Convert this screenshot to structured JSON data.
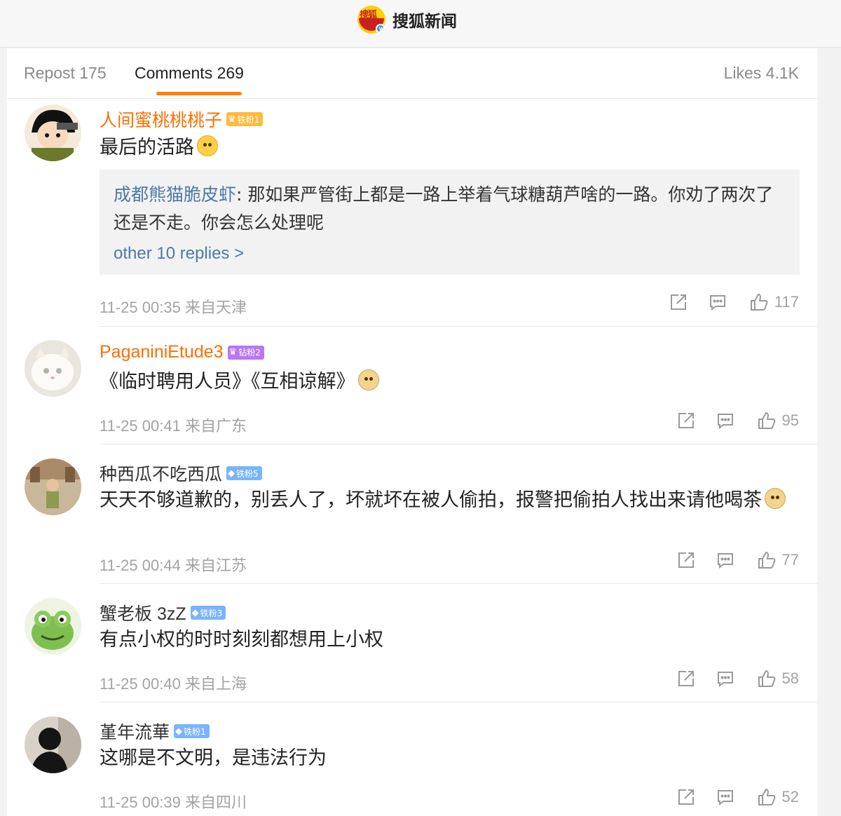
{
  "header": {
    "brand_name": "搜狐新闻",
    "logo_text": "搜狐"
  },
  "tabs": {
    "repost": "Repost 175",
    "comments": "Comments 269",
    "likes": "Likes 4.1K"
  },
  "comments": [
    {
      "username": "人间蜜桃桃桃子",
      "badge": "铁粉1",
      "text": "最后的活路",
      "reply": {
        "user": "成都熊猫脆皮虾",
        "text": ": 那如果严管街上都是一路上举着气球糖葫芦啥的一路。你劝了两次了还是不走。你会怎么处理呢",
        "more": "other 10 replies >"
      },
      "time": "11-25 00:35",
      "location": "来自天津",
      "likes": "117"
    },
    {
      "username": "PaganiniEtude3",
      "badge": "钻粉2",
      "text": "《临时聘用人员》《互相谅解》",
      "time": "11-25 00:41",
      "location": "来自广东",
      "likes": "95"
    },
    {
      "username": "种西瓜不吃西瓜",
      "badge": "铁粉5",
      "text": "天天不够道歉的，别丢人了，坏就坏在被人偷拍，报警把偷拍人找出来请他喝茶",
      "time": "11-25 00:44",
      "location": "来自江苏",
      "likes": "77"
    },
    {
      "username": "蟹老板 3zZ",
      "badge": "铁粉3",
      "text": "有点小权的时时刻刻都想用上小权",
      "time": "11-25 00:40",
      "location": "来自上海",
      "likes": "58"
    },
    {
      "username": "堇年流華",
      "badge": "铁粉1",
      "text": "这哪是不文明，是违法行为",
      "time": "11-25 00:39",
      "location": "来自四川",
      "likes": "52"
    }
  ]
}
